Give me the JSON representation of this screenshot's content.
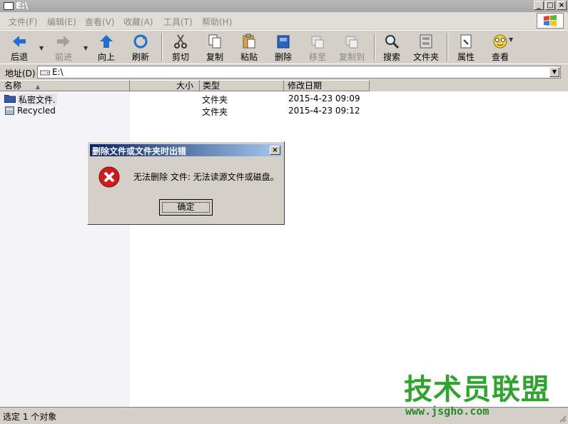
{
  "window": {
    "title": "E:\\"
  },
  "menu": [
    "文件(F)",
    "编辑(E)",
    "查看(V)",
    "收藏(A)",
    "工具(T)",
    "帮助(H)"
  ],
  "toolbar": [
    {
      "label": "后退",
      "icon": "back-arrow-icon",
      "enabled": true
    },
    {
      "label": "前进",
      "icon": "forward-arrow-icon",
      "enabled": false
    },
    {
      "label": "向上",
      "icon": "up-arrow-icon",
      "enabled": true
    },
    {
      "label": "刷新",
      "icon": "refresh-icon",
      "enabled": true
    },
    {
      "label": "剪切",
      "icon": "scissors-icon",
      "enabled": true
    },
    {
      "label": "复制",
      "icon": "copy-icon",
      "enabled": true
    },
    {
      "label": "粘贴",
      "icon": "paste-icon",
      "enabled": true
    },
    {
      "label": "删除",
      "icon": "delete-icon",
      "enabled": true
    },
    {
      "label": "移至",
      "icon": "move-to-icon",
      "enabled": false
    },
    {
      "label": "复制到",
      "icon": "copy-to-icon",
      "enabled": false
    },
    {
      "label": "搜索",
      "icon": "search-icon",
      "enabled": true
    },
    {
      "label": "文件夹",
      "icon": "folders-icon",
      "enabled": true
    },
    {
      "label": "属性",
      "icon": "properties-icon",
      "enabled": true
    },
    {
      "label": "查看",
      "icon": "view-icon",
      "enabled": true
    }
  ],
  "address": {
    "label": "地址(D)",
    "value": "E:\\"
  },
  "columns": [
    "名称",
    "大小",
    "类型",
    "修改日期"
  ],
  "files": [
    {
      "name": "私密文件.",
      "size": "",
      "type": "文件夹",
      "modified": "2015-4-23 09:09",
      "icon": "folder-icon"
    },
    {
      "name": "Recycled",
      "size": "",
      "type": "文件夹",
      "modified": "2015-4-23 09:12",
      "icon": "recycle-folder-icon"
    }
  ],
  "dialog": {
    "title": "删除文件或文件夹时出错",
    "message": "无法删除 文件: 无法读源文件或磁盘。",
    "ok_label": "确定",
    "close_label": "×"
  },
  "status": {
    "text": "选定 1 个对象"
  },
  "watermark": {
    "text": "技术员联盟",
    "url": "www.jsgho.com"
  },
  "colors": {
    "titlebar_inactive": "#a8a8a8",
    "dialog_title": "#0a246a",
    "watermark_green": "#2fa42f",
    "error_red": "#d11b1b"
  }
}
